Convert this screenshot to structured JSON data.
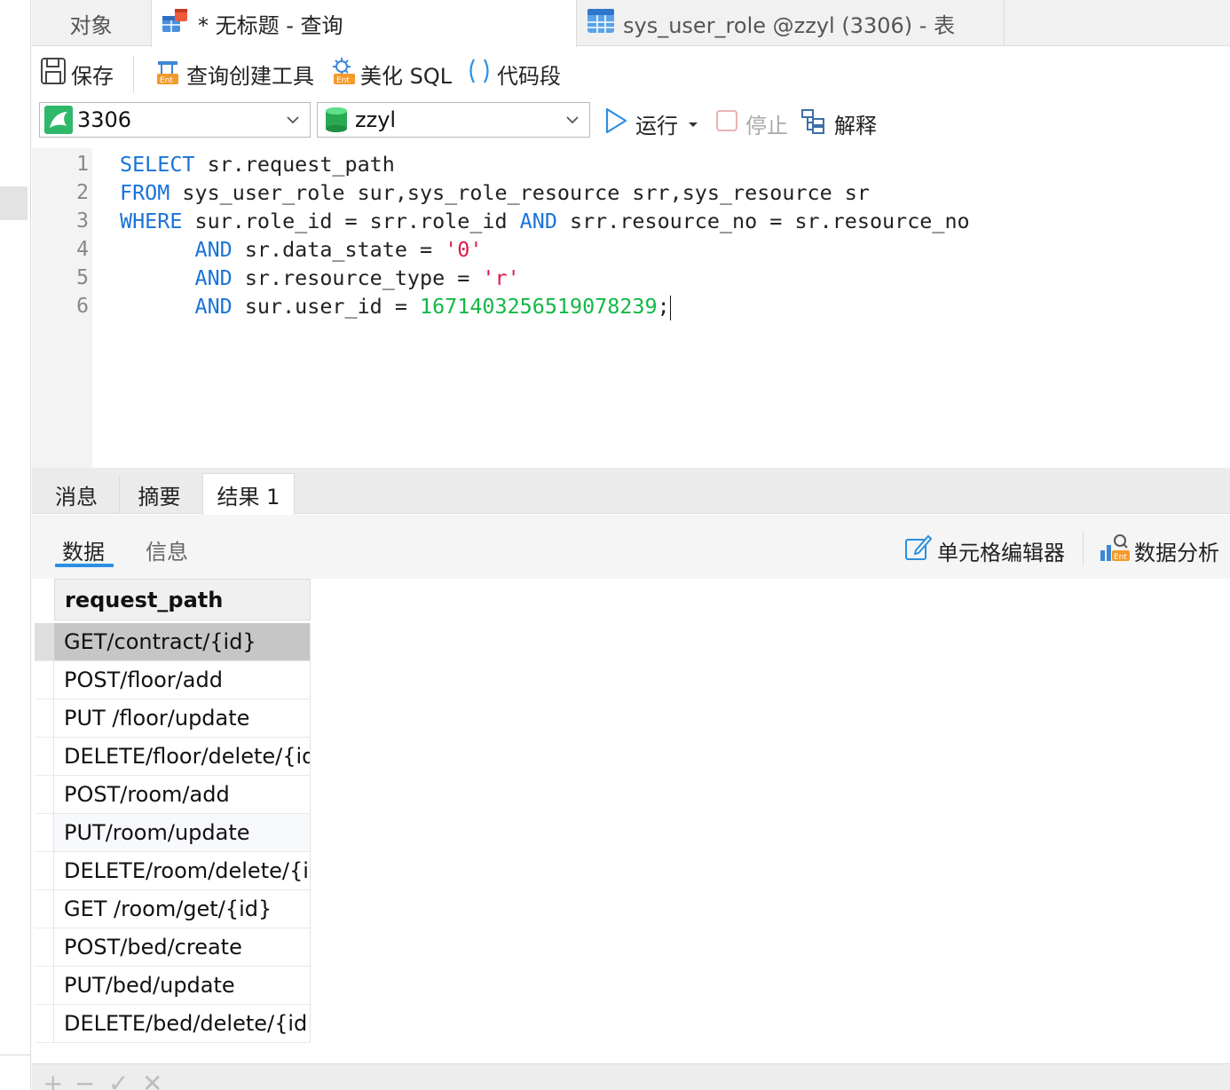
{
  "tabs": {
    "objects": "对象",
    "query": "* 无标题 - 查询",
    "table": "sys_user_role @zzyl (3306) - 表"
  },
  "toolbar": {
    "save": "保存",
    "query_builder": "查询创建工具",
    "beautify": "美化 SQL",
    "snippet": "代码段",
    "run": "运行",
    "stop": "停止",
    "explain": "解释"
  },
  "connection": {
    "selected": "3306"
  },
  "database": {
    "selected": "zzyl"
  },
  "editor": {
    "line_numbers": [
      "1",
      "2",
      "3",
      "4",
      "5",
      "6"
    ],
    "lines": [
      [
        {
          "t": "SELECT",
          "c": "kw"
        },
        {
          "t": " sr.request_path",
          "c": ""
        }
      ],
      [
        {
          "t": "FROM",
          "c": "kw"
        },
        {
          "t": " sys_user_role sur,sys_role_resource srr,sys_resource sr",
          "c": ""
        }
      ],
      [
        {
          "t": "WHERE",
          "c": "kw"
        },
        {
          "t": " sur.role_id = srr.role_id ",
          "c": ""
        },
        {
          "t": "AND",
          "c": "kw"
        },
        {
          "t": " srr.resource_no = sr.resource_no",
          "c": ""
        }
      ],
      [
        {
          "t": "      ",
          "c": ""
        },
        {
          "t": "AND",
          "c": "kw"
        },
        {
          "t": " sr.data_state = ",
          "c": ""
        },
        {
          "t": "'0'",
          "c": "str"
        }
      ],
      [
        {
          "t": "      ",
          "c": ""
        },
        {
          "t": "AND",
          "c": "kw"
        },
        {
          "t": " sr.resource_type = ",
          "c": ""
        },
        {
          "t": "'r'",
          "c": "str"
        }
      ],
      [
        {
          "t": "      ",
          "c": ""
        },
        {
          "t": "AND",
          "c": "kw"
        },
        {
          "t": " sur.user_id = ",
          "c": ""
        },
        {
          "t": "1671403256519078239",
          "c": "num"
        },
        {
          "t": ";",
          "c": ""
        }
      ]
    ]
  },
  "result_tabs": [
    "消息",
    "摘要",
    "结果 1"
  ],
  "sub_tabs": {
    "data": "数据",
    "info": "信息"
  },
  "result_tools": {
    "cell_editor": "单元格编辑器",
    "data_analysis": "数据分析"
  },
  "grid": {
    "column": "request_path",
    "rows": [
      "GET/contract/{id}",
      "POST/floor/add",
      "PUT /floor/update",
      "DELETE/floor/delete/{id",
      "POST/room/add",
      "PUT/room/update",
      "DELETE/room/delete/{ic",
      "GET /room/get/{id}",
      "POST/bed/create",
      "PUT/bed/update",
      "DELETE/bed/delete/{id}"
    ],
    "selected_row": 0
  },
  "bottom_icons": [
    "plus-icon",
    "minus-icon",
    "check-icon",
    "cancel-icon"
  ],
  "colors": {
    "keyword": "#1a73d9",
    "string": "#e01a4f",
    "number": "#13b846",
    "accent": "#2b8fe3"
  }
}
